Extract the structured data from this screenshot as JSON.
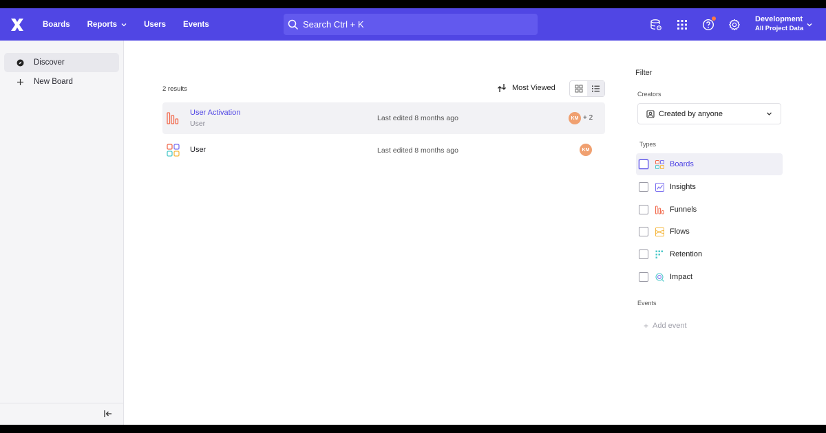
{
  "nav": {
    "items": [
      {
        "label": "Boards",
        "has_dropdown": false
      },
      {
        "label": "Reports",
        "has_dropdown": true
      },
      {
        "label": "Users",
        "has_dropdown": false
      },
      {
        "label": "Events",
        "has_dropdown": false
      }
    ],
    "search_placeholder": "Search  Ctrl + K",
    "icons": [
      "data-stack-icon",
      "app-grid-icon",
      "help-icon",
      "settings-icon"
    ],
    "project_name": "Development",
    "project_sub": "All Project Data",
    "brand_color": "#5046e4"
  },
  "sidebar": {
    "items": [
      {
        "label": "Discover",
        "icon": "compass-icon",
        "active": true
      },
      {
        "label": "New Board",
        "icon": "plus-icon",
        "active": false
      }
    ]
  },
  "main": {
    "results_count": "2 results",
    "sort_label": "Most Viewed",
    "view_modes": [
      "grid-view",
      "list-view"
    ],
    "active_view": "list-view",
    "rows": [
      {
        "title": "User Activation",
        "subtitle": "User",
        "edited": "Last edited 8 months ago",
        "avatar": "KM",
        "more": "+ 2",
        "icon": "funnel-chart-icon"
      },
      {
        "title": "User",
        "subtitle": "",
        "edited": "Last edited 8 months ago",
        "avatar": "KM",
        "more": "",
        "icon": "board-grid-icon"
      }
    ]
  },
  "filter": {
    "title": "Filter",
    "creators_label": "Creators",
    "creators_value": "Created by anyone",
    "types_label": "Types",
    "types": [
      {
        "label": "Boards",
        "icon": "boards-icon",
        "checked": false
      },
      {
        "label": "Insights",
        "icon": "insights-icon",
        "checked": false
      },
      {
        "label": "Funnels",
        "icon": "funnels-icon",
        "checked": false
      },
      {
        "label": "Flows",
        "icon": "flows-icon",
        "checked": false
      },
      {
        "label": "Retention",
        "icon": "retention-icon",
        "checked": false
      },
      {
        "label": "Impact",
        "icon": "impact-icon",
        "checked": false
      }
    ],
    "events_label": "Events",
    "add_event_label": "Add event"
  }
}
